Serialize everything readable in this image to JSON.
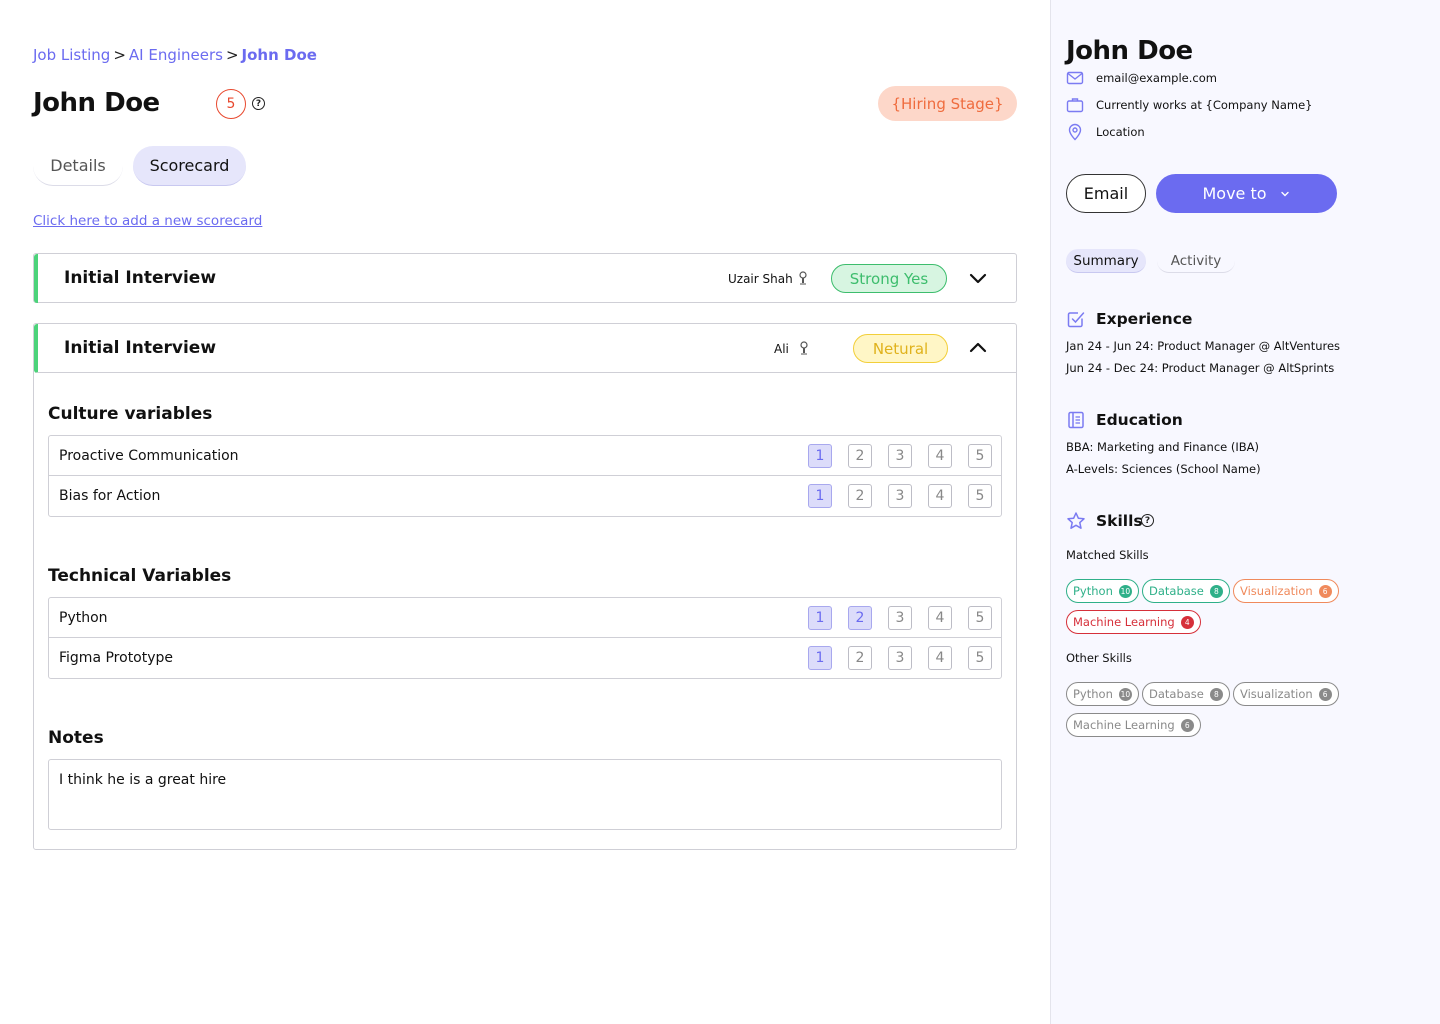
{
  "breadcrumb": {
    "items": [
      "Job Listing",
      "AI Engineers"
    ],
    "separator": ">",
    "current": "John Doe"
  },
  "candidate": {
    "name": "John Doe",
    "score": "5",
    "hiring_stage": "{Hiring Stage}"
  },
  "tabs": {
    "details": "Details",
    "scorecard": "Scorecard"
  },
  "add_scorecard_link": "Click here to add a new scorecard",
  "scorecards": [
    {
      "title": "Initial Interview",
      "interviewer": "Uzair Shah",
      "verdict": "Strong Yes",
      "expanded": false
    },
    {
      "title": "Initial Interview",
      "interviewer": "Ali",
      "verdict": "Netural",
      "expanded": true,
      "culture_title": "Culture variables",
      "culture": [
        {
          "label": "Proactive Communication",
          "rating": 1
        },
        {
          "label": "Bias for Action",
          "rating": 1
        }
      ],
      "technical_title": "Technical Variables",
      "technical": [
        {
          "label": "Python",
          "rating": 2
        },
        {
          "label": "Figma Prototype",
          "rating": 1
        }
      ],
      "rating_scale": [
        "1",
        "2",
        "3",
        "4",
        "5"
      ],
      "notes_title": "Notes",
      "notes": "I think he is a great hire"
    }
  ],
  "colors": {
    "accent": "#6b6bf0",
    "strong_yes": "#3dbd6d",
    "neutral": "#e0b21c",
    "hiring_stage": "#ef6c3e",
    "score": "#e8492f"
  },
  "side": {
    "name": "John Doe",
    "email": "email@example.com",
    "company": "Currently works at {Company Name}",
    "location": "Location",
    "email_button": "Email",
    "move_button": "Move to",
    "tabs": {
      "summary": "Summary",
      "activity": "Activity"
    },
    "experience": {
      "title": "Experience",
      "items": [
        "Jan 24 - Jun 24: Product Manager @ AltVentures",
        "Jun 24 - Dec 24: Product Manager @ AltSprints"
      ]
    },
    "education": {
      "title": "Education",
      "items": [
        "BBA: Marketing and Finance (IBA)",
        "A-Levels: Sciences (School Name)"
      ]
    },
    "skills": {
      "title": "Skills",
      "matched_label": "Matched Skills",
      "matched": [
        {
          "name": "Python",
          "count": "10",
          "color": "green"
        },
        {
          "name": "Database",
          "count": "8",
          "color": "green"
        },
        {
          "name": "Visualization",
          "count": "6",
          "color": "orange"
        },
        {
          "name": "Machine Learning",
          "count": "4",
          "color": "red"
        }
      ],
      "other_label": "Other Skills",
      "other": [
        {
          "name": "Python",
          "count": "10"
        },
        {
          "name": "Database",
          "count": "8"
        },
        {
          "name": "Visualization",
          "count": "6"
        },
        {
          "name": "Machine Learning",
          "count": "6"
        }
      ]
    }
  }
}
